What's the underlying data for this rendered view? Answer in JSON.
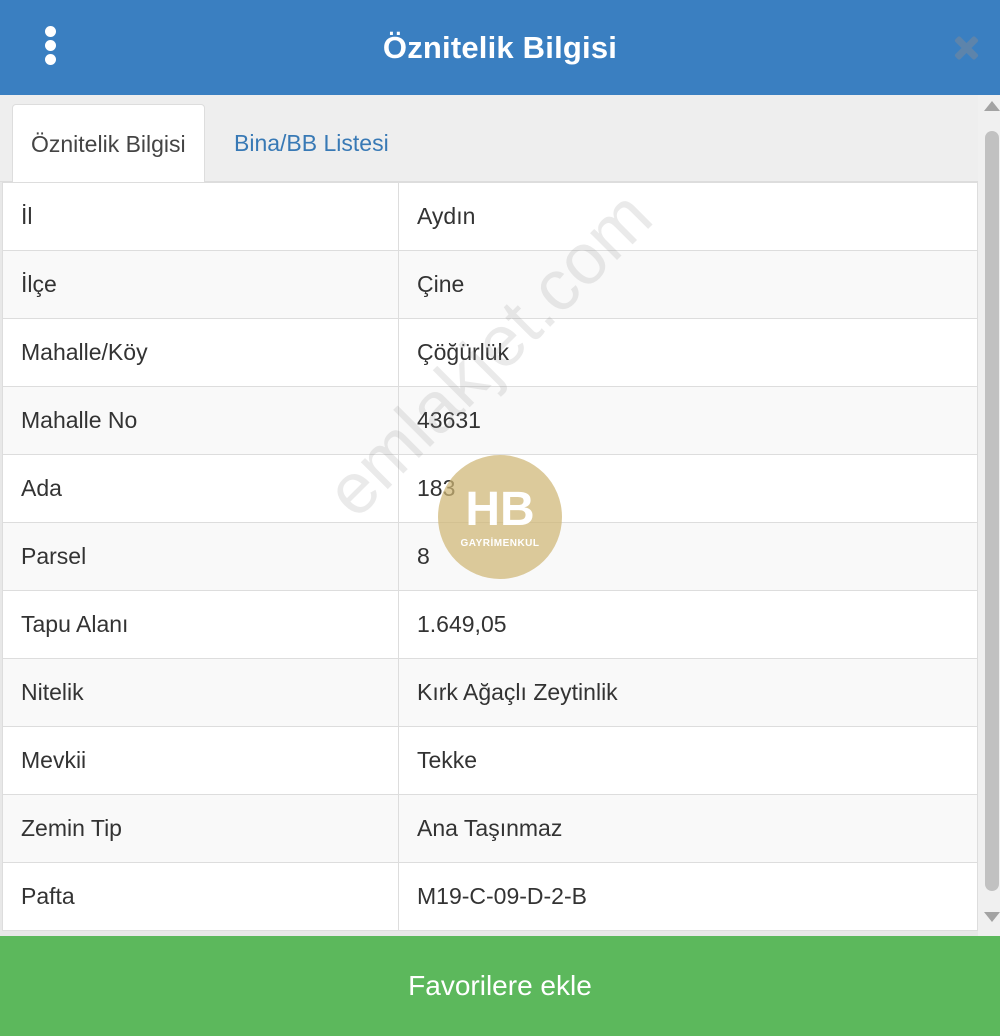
{
  "header": {
    "title": "Öznitelik Bilgisi",
    "menu_icon": "vertical-dots-icon",
    "close_icon": "close-icon",
    "background_color": "#3a7fc1"
  },
  "tabs": [
    {
      "label": "Öznitelik Bilgisi",
      "active": true
    },
    {
      "label": "Bina/BB Listesi",
      "active": false
    }
  ],
  "rows": [
    {
      "label": "İl",
      "value": "Aydın"
    },
    {
      "label": "İlçe",
      "value": "Çine"
    },
    {
      "label": "Mahalle/Köy",
      "value": "Çöğürlük"
    },
    {
      "label": "Mahalle No",
      "value": "43631"
    },
    {
      "label": "Ada",
      "value": "183"
    },
    {
      "label": "Parsel",
      "value": "8"
    },
    {
      "label": "Tapu Alanı",
      "value": "1.649,05"
    },
    {
      "label": "Nitelik",
      "value": "Kırk Ağaçlı Zeytinlik"
    },
    {
      "label": "Mevkii",
      "value": "Tekke"
    },
    {
      "label": "Zemin Tip",
      "value": "Ana Taşınmaz"
    },
    {
      "label": "Pafta",
      "value": "M19-C-09-D-2-B"
    }
  ],
  "watermark": {
    "text": "emlakjet.com",
    "logo_text": "HB",
    "logo_subtext": "GAYRİMENKUL"
  },
  "footer": {
    "button_label": "Favorilere ekle",
    "button_color": "#5cb85c"
  }
}
